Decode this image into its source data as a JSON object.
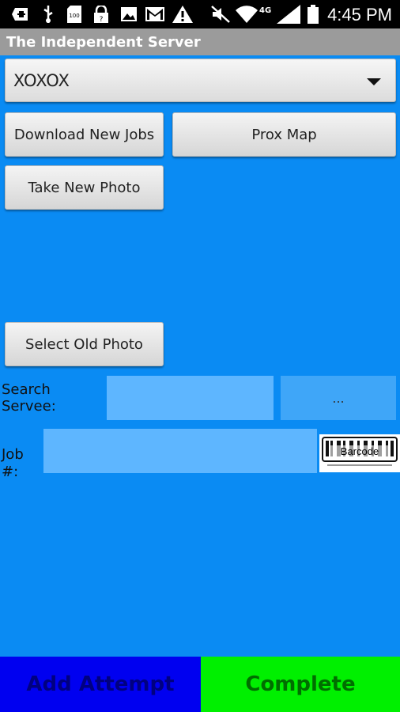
{
  "status_bar": {
    "time": "4:45 PM",
    "icons": [
      "add-icon",
      "usb-icon",
      "sd-card-icon",
      "lock-icon",
      "image-icon",
      "gmail-icon",
      "warning-icon",
      "mute-icon",
      "wifi-icon",
      "signal-icon",
      "battery-icon"
    ]
  },
  "app": {
    "title": "The Independent Server"
  },
  "spinner": {
    "value": "XOXOX"
  },
  "buttons": {
    "download_new_jobs": "Download New Jobs",
    "prox_map": "Prox Map",
    "take_new_photo": "Take New Photo",
    "select_old_photo": "Select Old Photo",
    "search_ellipsis": "..."
  },
  "search_servee": {
    "label": "Search Servee:",
    "value": ""
  },
  "job_number": {
    "label": "Job #:",
    "value": ""
  },
  "barcode": {
    "label": "Barcode"
  },
  "bottom": {
    "add_attempt": "Add Attempt",
    "complete": "Complete"
  },
  "colors": {
    "background": "#0a8bf3",
    "input_fill": "#5eb6ff",
    "add_attempt_bg": "#0000f0",
    "complete_bg": "#00f000"
  }
}
